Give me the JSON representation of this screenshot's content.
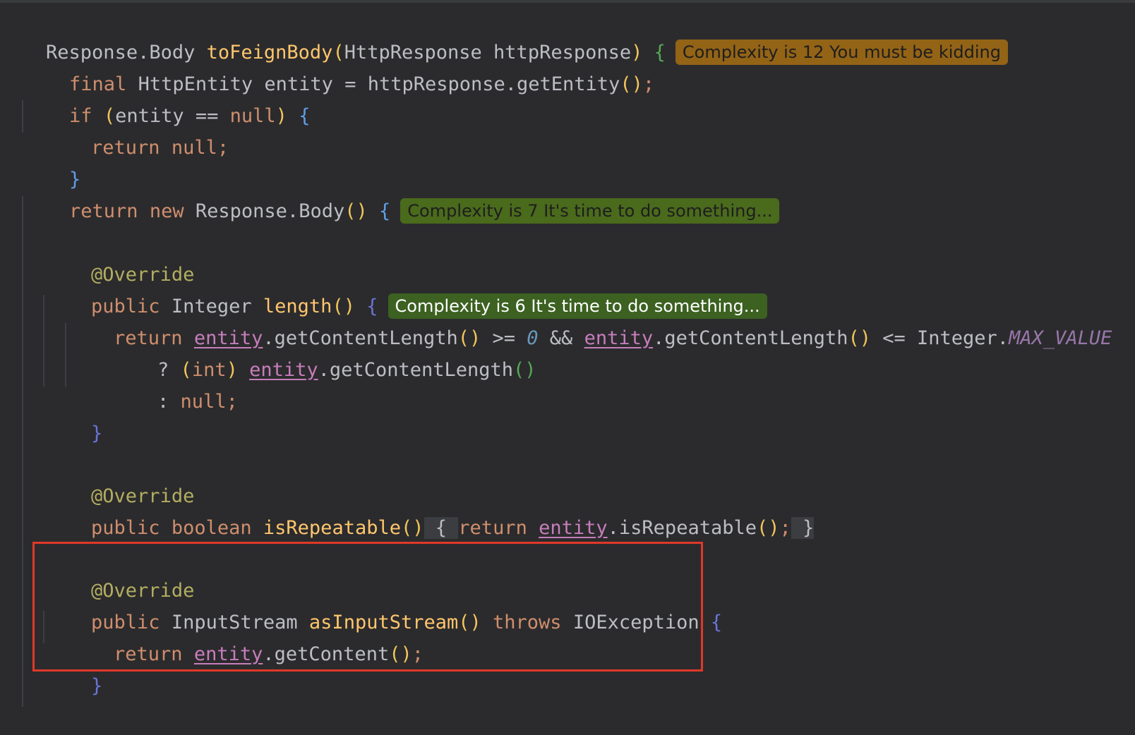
{
  "code": {
    "l1": {
      "type": "Response.Body",
      "method": "toFeignBody",
      "open": "(",
      "param_type": "HttpResponse",
      "param": "httpResponse",
      "close": ")",
      "brace": "{"
    },
    "l1_badge": "Complexity is 12 You must be kidding",
    "l2": {
      "kw": "final",
      "type": "HttpEntity",
      "rest": "entity = httpResponse.getEntity",
      "paren": "()",
      "semi": ";"
    },
    "l3": {
      "kw": "if",
      "open": "(",
      "cond": "entity == ",
      "nul": "null",
      "close": ")",
      "brace": "{"
    },
    "l4": {
      "kw": "return",
      "nul": "null",
      "semi": ";"
    },
    "l5": {
      "brace": "}"
    },
    "l6": {
      "kw": "return",
      "kw2": "new",
      "type": "Response.Body",
      "paren": "()",
      "brace": "{"
    },
    "l6_badge": "Complexity is 7 It's time to do something...",
    "l8": {
      "ann": "@Override"
    },
    "l9": {
      "kw": "public",
      "type": "Integer",
      "method": "length",
      "paren": "()",
      "brace": "{"
    },
    "l9_badge": "Complexity is 6 It's time to do something...",
    "l10": {
      "kw": "return",
      "fld1": "entity",
      "m1": ".getContentLength",
      "p1": "()",
      "op1": " >= ",
      "num": "0",
      "op2": " && ",
      "fld2": "entity",
      "m2": ".getContentLength",
      "p2": "()",
      "op3": " <= Integer.",
      "const": "MAX_VALUE"
    },
    "l11": {
      "q": "? ",
      "open": "(",
      "kw": "int",
      "close": ")",
      "fld": "entity",
      "m": ".getContentLength",
      "paren": "()"
    },
    "l12": {
      "c": ": ",
      "nul": "null",
      "semi": ";"
    },
    "l13": {
      "brace": "}"
    },
    "l15": {
      "ann": "@Override"
    },
    "l16": {
      "kw": "public",
      "kw2": "boolean",
      "method": "isRepeatable",
      "paren": "()",
      "open": "{",
      "kw3": "return",
      "fld": "entity",
      "m": ".isRepeatable",
      "p": "()",
      "semi": ";",
      "close": "}"
    },
    "l18": {
      "ann": "@Override"
    },
    "l19": {
      "kw": "public",
      "type": "InputStream",
      "method": "asInputStream",
      "paren": "()",
      "kw2": "throws",
      "exc": "IOException",
      "brace": "{"
    },
    "l20": {
      "kw": "return",
      "fld": "entity",
      "m": ".getContent",
      "p": "()",
      "semi": ";"
    },
    "l21": {
      "brace": "}"
    }
  },
  "colors": {
    "background": "#2b2b2d",
    "keyword": "#cf8e6d",
    "method": "#ffc66d",
    "field": "#c77dbb",
    "annotation": "#b3ae60",
    "badge_orange": "#936316",
    "badge_green": "#4a6a1c",
    "highlight_box": "#e0382a"
  }
}
